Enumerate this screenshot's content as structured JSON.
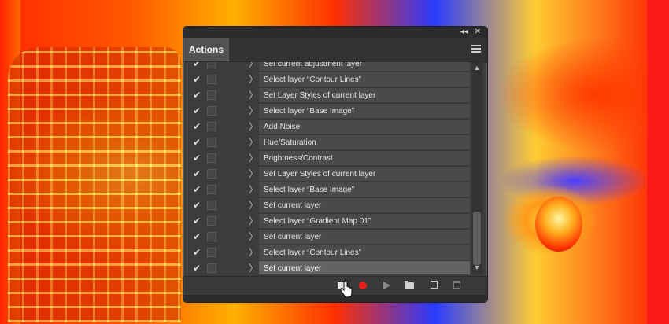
{
  "panel": {
    "collapse_icon": "collapse-icon",
    "close_icon": "close-icon",
    "tab_label": "Actions",
    "menu_icon": "panel-menu-icon"
  },
  "actions": [
    {
      "label": "Set current adjustment layer",
      "checked": true,
      "selected": false
    },
    {
      "label": "Select layer “Contour Lines”",
      "checked": true,
      "selected": false
    },
    {
      "label": "Set Layer Styles of current layer",
      "checked": true,
      "selected": false
    },
    {
      "label": "Select layer “Base Image”",
      "checked": true,
      "selected": false
    },
    {
      "label": "Add Noise",
      "checked": true,
      "selected": false
    },
    {
      "label": "Hue/Saturation",
      "checked": true,
      "selected": false
    },
    {
      "label": "Brightness/Contrast",
      "checked": true,
      "selected": false
    },
    {
      "label": "Set Layer Styles of current layer",
      "checked": true,
      "selected": false
    },
    {
      "label": "Select layer “Base Image”",
      "checked": true,
      "selected": false
    },
    {
      "label": "Set current layer",
      "checked": true,
      "selected": false
    },
    {
      "label": "Select layer “Gradient Map 01”",
      "checked": true,
      "selected": false
    },
    {
      "label": "Set current layer",
      "checked": true,
      "selected": false
    },
    {
      "label": "Select layer “Contour Lines”",
      "checked": true,
      "selected": false
    },
    {
      "label": "Set current layer",
      "checked": true,
      "selected": true
    }
  ],
  "glyphs": {
    "check": "✔",
    "chevron": "〉",
    "close": "✕",
    "collapse": "◂◂",
    "up": "▲",
    "down": "▼"
  },
  "toolbar": {
    "buttons": [
      "stop-playing-icon",
      "record-icon",
      "play-icon",
      "new-set-icon",
      "new-action-icon",
      "delete-icon"
    ]
  },
  "colors": {
    "panel_bg": "#3c3c3c",
    "row_bg": "#4a4a4a",
    "selected_row_bg": "#636363",
    "record_red": "#e8201c"
  }
}
